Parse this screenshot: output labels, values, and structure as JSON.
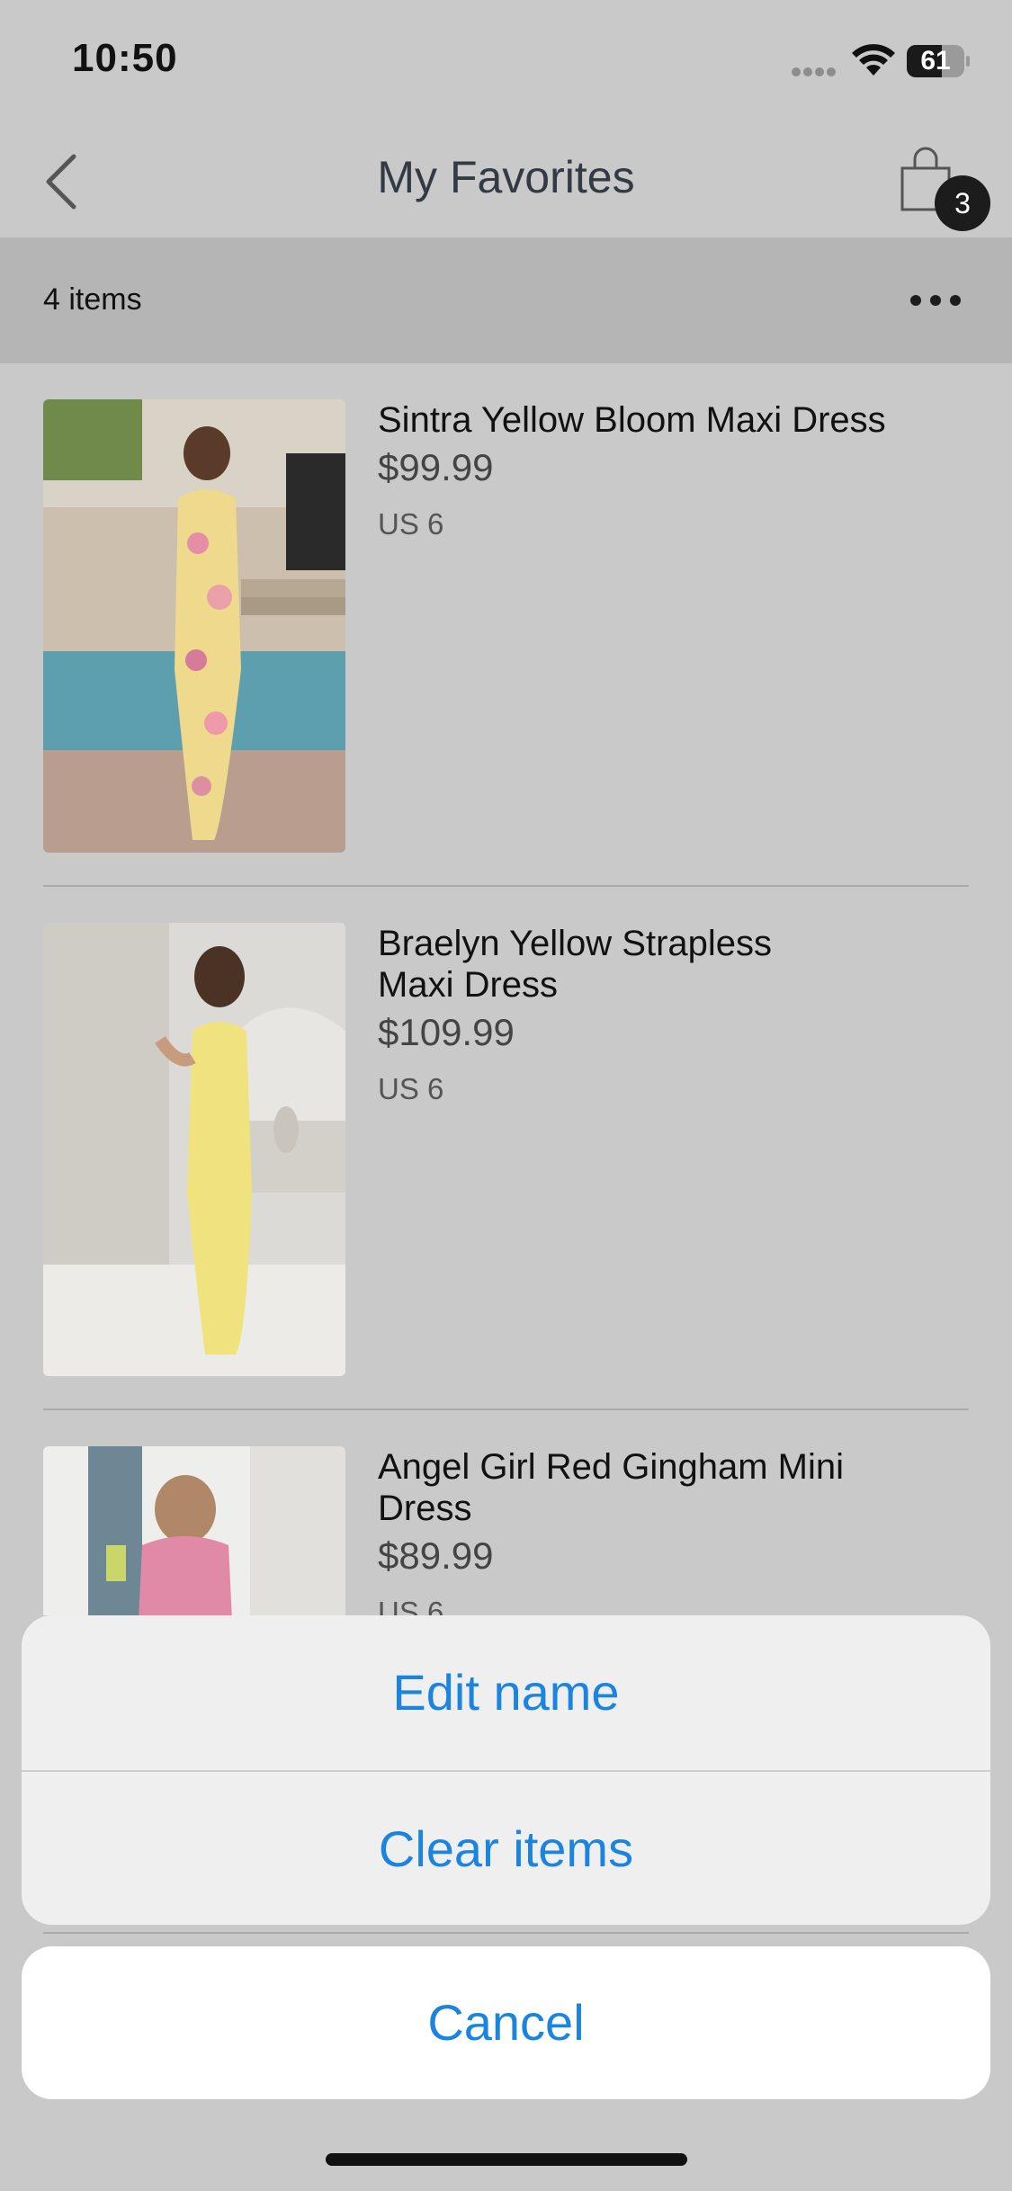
{
  "status_bar": {
    "time": "10:50",
    "battery_level": "61",
    "battery_fraction": 0.61,
    "signal_icon": "signal-dots-icon",
    "wifi_icon": "wifi-icon",
    "battery_icon": "battery-icon"
  },
  "nav": {
    "back_icon": "chevron-left-icon",
    "title": "My Favorites",
    "cart_icon": "shopping-bag-icon",
    "cart_count": "3"
  },
  "list_header": {
    "count_label": "4 items",
    "more_icon": "ellipsis-icon"
  },
  "items": [
    {
      "name": "Sintra Yellow Bloom Maxi Dress",
      "price": "$99.99",
      "size": "US 6"
    },
    {
      "name": "Braelyn Yellow Strapless Maxi Dress",
      "price": "$109.99",
      "size": "US 6"
    },
    {
      "name": "Angel Girl Red Gingham Mini Dress",
      "price": "$89.99",
      "size": "US 6"
    }
  ],
  "action_sheet": {
    "edit_name": "Edit name",
    "clear_items": "Clear items",
    "cancel": "Cancel"
  },
  "colors": {
    "accent": "#1a84e0",
    "overlay_background": "#c9c9c9",
    "header_strip": "#b5b5b5"
  }
}
